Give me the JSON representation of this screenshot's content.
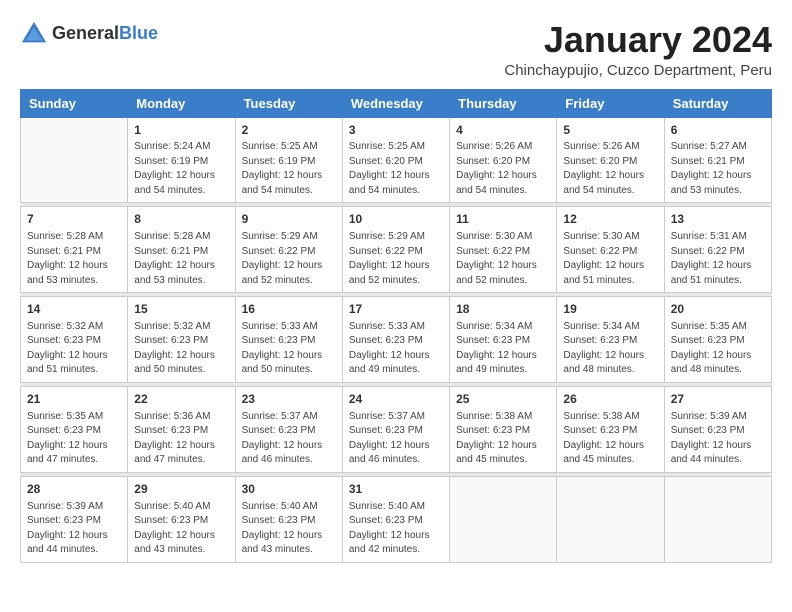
{
  "logo": {
    "general": "General",
    "blue": "Blue"
  },
  "title": "January 2024",
  "location": "Chinchaypujio, Cuzco Department, Peru",
  "weekdays": [
    "Sunday",
    "Monday",
    "Tuesday",
    "Wednesday",
    "Thursday",
    "Friday",
    "Saturday"
  ],
  "weeks": [
    [
      {
        "day": "",
        "sunrise": "",
        "sunset": "",
        "daylight": ""
      },
      {
        "day": "1",
        "sunrise": "Sunrise: 5:24 AM",
        "sunset": "Sunset: 6:19 PM",
        "daylight": "Daylight: 12 hours and 54 minutes."
      },
      {
        "day": "2",
        "sunrise": "Sunrise: 5:25 AM",
        "sunset": "Sunset: 6:19 PM",
        "daylight": "Daylight: 12 hours and 54 minutes."
      },
      {
        "day": "3",
        "sunrise": "Sunrise: 5:25 AM",
        "sunset": "Sunset: 6:20 PM",
        "daylight": "Daylight: 12 hours and 54 minutes."
      },
      {
        "day": "4",
        "sunrise": "Sunrise: 5:26 AM",
        "sunset": "Sunset: 6:20 PM",
        "daylight": "Daylight: 12 hours and 54 minutes."
      },
      {
        "day": "5",
        "sunrise": "Sunrise: 5:26 AM",
        "sunset": "Sunset: 6:20 PM",
        "daylight": "Daylight: 12 hours and 54 minutes."
      },
      {
        "day": "6",
        "sunrise": "Sunrise: 5:27 AM",
        "sunset": "Sunset: 6:21 PM",
        "daylight": "Daylight: 12 hours and 53 minutes."
      }
    ],
    [
      {
        "day": "7",
        "sunrise": "Sunrise: 5:28 AM",
        "sunset": "Sunset: 6:21 PM",
        "daylight": "Daylight: 12 hours and 53 minutes."
      },
      {
        "day": "8",
        "sunrise": "Sunrise: 5:28 AM",
        "sunset": "Sunset: 6:21 PM",
        "daylight": "Daylight: 12 hours and 53 minutes."
      },
      {
        "day": "9",
        "sunrise": "Sunrise: 5:29 AM",
        "sunset": "Sunset: 6:22 PM",
        "daylight": "Daylight: 12 hours and 52 minutes."
      },
      {
        "day": "10",
        "sunrise": "Sunrise: 5:29 AM",
        "sunset": "Sunset: 6:22 PM",
        "daylight": "Daylight: 12 hours and 52 minutes."
      },
      {
        "day": "11",
        "sunrise": "Sunrise: 5:30 AM",
        "sunset": "Sunset: 6:22 PM",
        "daylight": "Daylight: 12 hours and 52 minutes."
      },
      {
        "day": "12",
        "sunrise": "Sunrise: 5:30 AM",
        "sunset": "Sunset: 6:22 PM",
        "daylight": "Daylight: 12 hours and 51 minutes."
      },
      {
        "day": "13",
        "sunrise": "Sunrise: 5:31 AM",
        "sunset": "Sunset: 6:22 PM",
        "daylight": "Daylight: 12 hours and 51 minutes."
      }
    ],
    [
      {
        "day": "14",
        "sunrise": "Sunrise: 5:32 AM",
        "sunset": "Sunset: 6:23 PM",
        "daylight": "Daylight: 12 hours and 51 minutes."
      },
      {
        "day": "15",
        "sunrise": "Sunrise: 5:32 AM",
        "sunset": "Sunset: 6:23 PM",
        "daylight": "Daylight: 12 hours and 50 minutes."
      },
      {
        "day": "16",
        "sunrise": "Sunrise: 5:33 AM",
        "sunset": "Sunset: 6:23 PM",
        "daylight": "Daylight: 12 hours and 50 minutes."
      },
      {
        "day": "17",
        "sunrise": "Sunrise: 5:33 AM",
        "sunset": "Sunset: 6:23 PM",
        "daylight": "Daylight: 12 hours and 49 minutes."
      },
      {
        "day": "18",
        "sunrise": "Sunrise: 5:34 AM",
        "sunset": "Sunset: 6:23 PM",
        "daylight": "Daylight: 12 hours and 49 minutes."
      },
      {
        "day": "19",
        "sunrise": "Sunrise: 5:34 AM",
        "sunset": "Sunset: 6:23 PM",
        "daylight": "Daylight: 12 hours and 48 minutes."
      },
      {
        "day": "20",
        "sunrise": "Sunrise: 5:35 AM",
        "sunset": "Sunset: 6:23 PM",
        "daylight": "Daylight: 12 hours and 48 minutes."
      }
    ],
    [
      {
        "day": "21",
        "sunrise": "Sunrise: 5:35 AM",
        "sunset": "Sunset: 6:23 PM",
        "daylight": "Daylight: 12 hours and 47 minutes."
      },
      {
        "day": "22",
        "sunrise": "Sunrise: 5:36 AM",
        "sunset": "Sunset: 6:23 PM",
        "daylight": "Daylight: 12 hours and 47 minutes."
      },
      {
        "day": "23",
        "sunrise": "Sunrise: 5:37 AM",
        "sunset": "Sunset: 6:23 PM",
        "daylight": "Daylight: 12 hours and 46 minutes."
      },
      {
        "day": "24",
        "sunrise": "Sunrise: 5:37 AM",
        "sunset": "Sunset: 6:23 PM",
        "daylight": "Daylight: 12 hours and 46 minutes."
      },
      {
        "day": "25",
        "sunrise": "Sunrise: 5:38 AM",
        "sunset": "Sunset: 6:23 PM",
        "daylight": "Daylight: 12 hours and 45 minutes."
      },
      {
        "day": "26",
        "sunrise": "Sunrise: 5:38 AM",
        "sunset": "Sunset: 6:23 PM",
        "daylight": "Daylight: 12 hours and 45 minutes."
      },
      {
        "day": "27",
        "sunrise": "Sunrise: 5:39 AM",
        "sunset": "Sunset: 6:23 PM",
        "daylight": "Daylight: 12 hours and 44 minutes."
      }
    ],
    [
      {
        "day": "28",
        "sunrise": "Sunrise: 5:39 AM",
        "sunset": "Sunset: 6:23 PM",
        "daylight": "Daylight: 12 hours and 44 minutes."
      },
      {
        "day": "29",
        "sunrise": "Sunrise: 5:40 AM",
        "sunset": "Sunset: 6:23 PM",
        "daylight": "Daylight: 12 hours and 43 minutes."
      },
      {
        "day": "30",
        "sunrise": "Sunrise: 5:40 AM",
        "sunset": "Sunset: 6:23 PM",
        "daylight": "Daylight: 12 hours and 43 minutes."
      },
      {
        "day": "31",
        "sunrise": "Sunrise: 5:40 AM",
        "sunset": "Sunset: 6:23 PM",
        "daylight": "Daylight: 12 hours and 42 minutes."
      },
      {
        "day": "",
        "sunrise": "",
        "sunset": "",
        "daylight": ""
      },
      {
        "day": "",
        "sunrise": "",
        "sunset": "",
        "daylight": ""
      },
      {
        "day": "",
        "sunrise": "",
        "sunset": "",
        "daylight": ""
      }
    ]
  ]
}
